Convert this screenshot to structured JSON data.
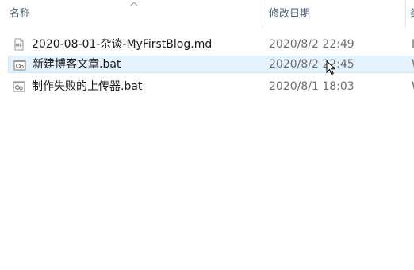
{
  "columns": {
    "name": "名称",
    "modified": "修改日期",
    "type": "类"
  },
  "sort": {
    "column": "name",
    "direction": "ascending",
    "icon": "sort-ascending-chevron-icon"
  },
  "files": [
    {
      "name": "2020-08-01-杂谈-MyFirstBlog.md",
      "modified": "2020/8/2 22:49",
      "type": "M",
      "icon": "markdown-file-icon",
      "selected": false
    },
    {
      "name": "新建博客文章.bat",
      "modified": "2020/8/2 22:45",
      "type": "W",
      "icon": "batch-file-icon",
      "selected": true
    },
    {
      "name": "制作失败的上传器.bat",
      "modified": "2020/8/1 18:03",
      "type": "W",
      "icon": "batch-file-icon",
      "selected": false
    }
  ],
  "colors": {
    "selection_background": "#e5f3ff",
    "selection_border": "#cce8ff",
    "header_text": "#4c607a",
    "date_text": "#6d6d6d"
  }
}
